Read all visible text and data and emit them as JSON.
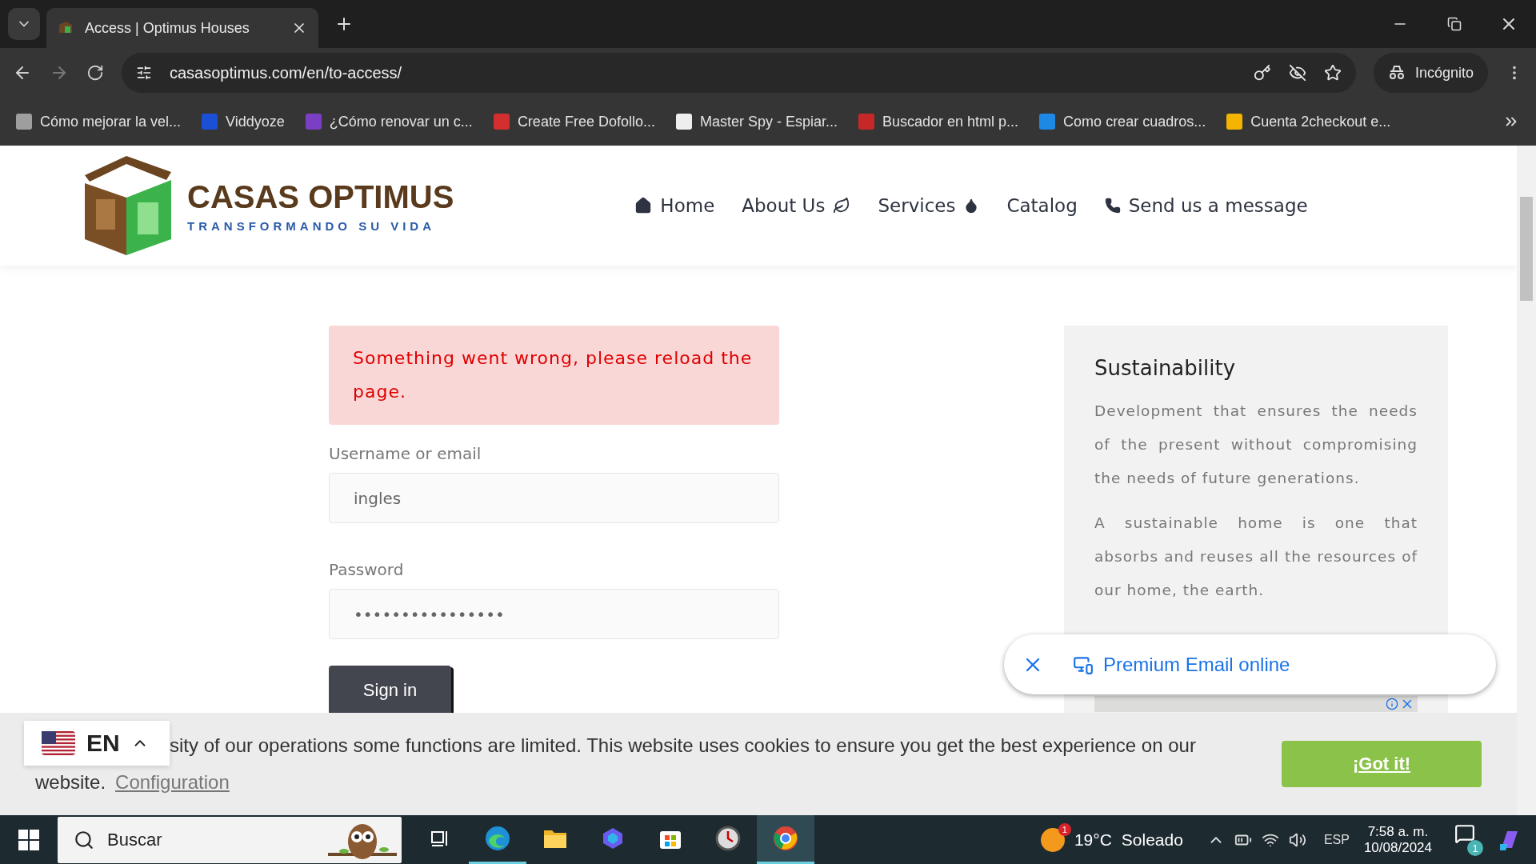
{
  "browser": {
    "tabs": [
      {
        "title": "Access | Optimus Houses",
        "selected": true
      }
    ],
    "url": "casasoptimus.com/en/to-access/",
    "profile": "Incógnito",
    "bookmarks": [
      {
        "label": "Cómo mejorar la vel...",
        "color": "#9e9e9e"
      },
      {
        "label": "Viddyoze",
        "color": "#1a4fd6"
      },
      {
        "label": "¿Cómo renovar un c...",
        "color": "#7b3fc4"
      },
      {
        "label": "Create Free Dofollo...",
        "color": "#d32f2f"
      },
      {
        "label": "Master Spy - Espiar...",
        "color": "#eeeeee"
      },
      {
        "label": "Buscador en html p...",
        "color": "#c62828"
      },
      {
        "label": "Como crear cuadros...",
        "color": "#1e88e5"
      },
      {
        "label": "Cuenta 2checkout e...",
        "color": "#f4b400"
      }
    ]
  },
  "site": {
    "logo": {
      "name": "CASAS OPTIMUS",
      "tagline": "TRANSFORMANDO SU VIDA"
    },
    "nav": [
      {
        "label": "Home",
        "kind": "home"
      },
      {
        "label": "About Us",
        "kind": "leaf"
      },
      {
        "label": "Services",
        "kind": "drop"
      },
      {
        "label": "Catalog",
        "kind": "plain"
      },
      {
        "label": "Send us a message",
        "kind": "phone"
      }
    ]
  },
  "alert": "Something went wrong, please reload the page.",
  "form": {
    "fields": [
      {
        "label": "Username or email",
        "value": "ingles"
      },
      {
        "label": "Password",
        "value": "••••••••••••••••"
      }
    ],
    "submit": "Sign in"
  },
  "sidebar": {
    "title": "Sustainability",
    "paragraphs": [
      "Development that ensures the needs of the present without compromising the needs of future generations.",
      "A sustainable home is one that absorbs and reuses all the resources of our home, the earth."
    ]
  },
  "ad_popup": {
    "label": "Premium Email online"
  },
  "cookie": {
    "line1": "sity of our operations some functions are limited. This website uses cookies to ensure you get the best experience on our",
    "line2": "website.",
    "link": "Configuration",
    "button": "¡Got it!"
  },
  "language": {
    "code": "EN"
  },
  "taskbar": {
    "search": "Buscar",
    "apps": [
      {
        "kind": "taskview",
        "running": false,
        "selected": false
      },
      {
        "kind": "edge",
        "running": true,
        "selected": false
      },
      {
        "kind": "files",
        "running": false,
        "selected": false
      },
      {
        "kind": "copilot",
        "running": false,
        "selected": false
      },
      {
        "kind": "store",
        "running": false,
        "selected": false
      },
      {
        "kind": "clock",
        "running": false,
        "selected": false
      },
      {
        "kind": "chrome",
        "running": true,
        "selected": true
      }
    ],
    "weather": {
      "badge": "1",
      "temp": "19°C",
      "condition": "Soleado"
    },
    "lang": "ESP",
    "time": "7:58 a. m.",
    "date": "10/08/2024",
    "notifications": "1"
  }
}
